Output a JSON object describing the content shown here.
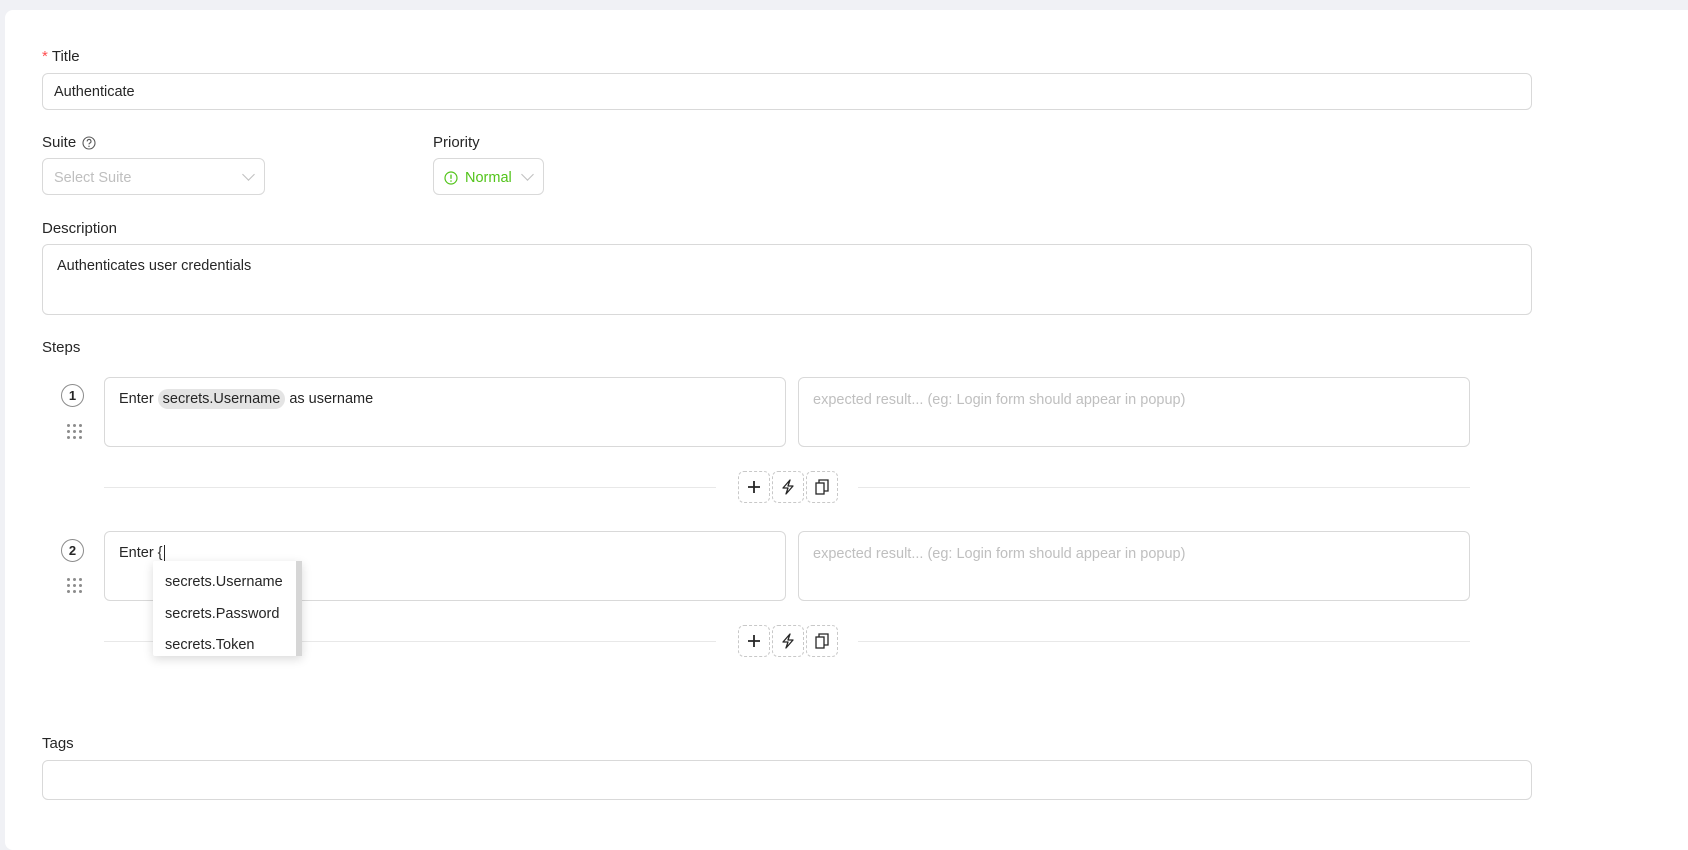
{
  "title": {
    "label": "Title",
    "required_mark": "*",
    "value": "Authenticate"
  },
  "suite": {
    "label": "Suite",
    "placeholder": "Select Suite"
  },
  "priority": {
    "label": "Priority",
    "value": "Normal",
    "color": "#52c41a"
  },
  "description": {
    "label": "Description",
    "value": "Authenticates user credentials"
  },
  "steps": {
    "label": "Steps",
    "items": [
      {
        "number": "1",
        "prefix": "Enter",
        "variable": "secrets.Username",
        "suffix": "as username",
        "expected_placeholder": "expected result... (eg: Login form should appear in popup)"
      },
      {
        "number": "2",
        "text": "Enter {",
        "expected_placeholder": "expected result... (eg: Login form should appear in popup)"
      }
    ],
    "autocomplete": [
      "secrets.Username",
      "secrets.Password",
      "secrets.Token"
    ]
  },
  "tags": {
    "label": "Tags"
  }
}
